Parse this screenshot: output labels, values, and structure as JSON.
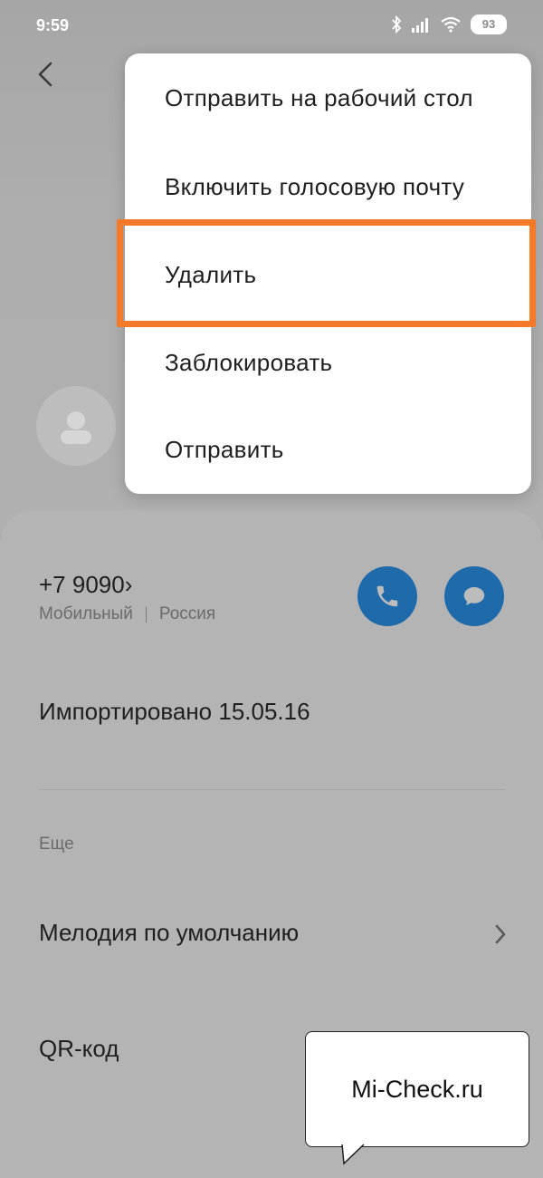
{
  "status_bar": {
    "time": "9:59",
    "battery": "93",
    "icons": [
      "bluetooth-icon",
      "signal-icon",
      "wifi-icon",
      "battery-icon"
    ]
  },
  "contact": {
    "phone_number": "+7 9090›",
    "phone_type": "Мобильный",
    "phone_region": "Россия",
    "imported": "Импортировано 15.05.16"
  },
  "more": {
    "section_label": "Еще",
    "ringtone_label": "Мелодия по умолчанию",
    "qr_label": "QR-код"
  },
  "menu": {
    "items": [
      "Отправить на рабочий стол",
      "Включить голосовую почту",
      "Удалить",
      "Заблокировать",
      "Отправить"
    ],
    "highlighted_item": "Удалить",
    "highlight_color": "#f47a2a"
  },
  "watermark": {
    "text": "Mi-Check.ru"
  },
  "colors": {
    "accent": "#1f6aaa",
    "scrim": "#a9a9a9",
    "menu_bg": "#ffffff"
  }
}
